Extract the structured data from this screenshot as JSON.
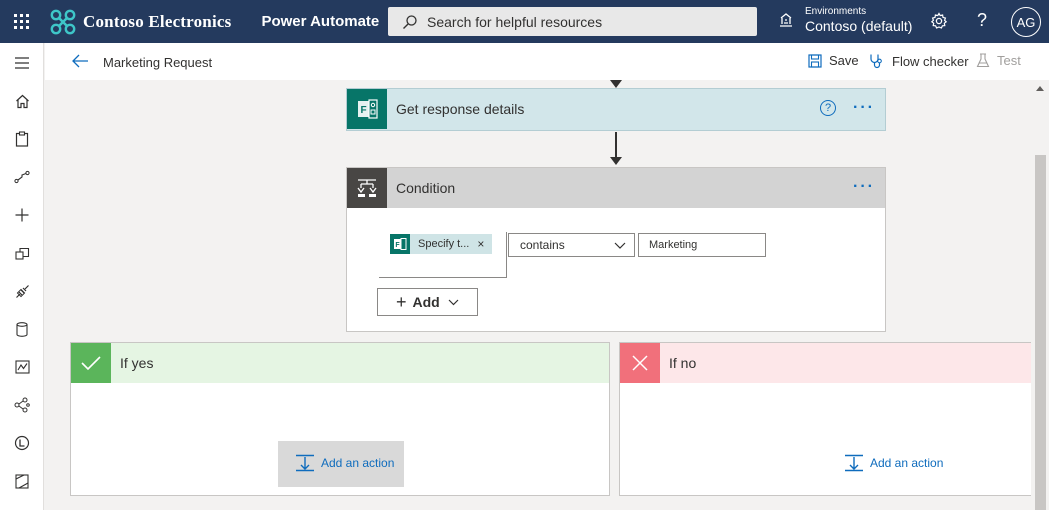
{
  "header": {
    "brand": "Contoso Electronics",
    "app": "Power Automate",
    "search_placeholder": "Search for helpful resources",
    "environment_label": "Environments",
    "environment_value": "Contoso (default)",
    "user_initials": "AG"
  },
  "rail": {
    "items": [
      "home-icon",
      "clipboard-icon",
      "flow-icon",
      "plus-icon",
      "templates-icon",
      "connector-icon",
      "data-icon",
      "monitor-icon",
      "ai-icon",
      "process-icon",
      "solutions-icon"
    ]
  },
  "command_bar": {
    "title": "Marketing Request",
    "save": "Save",
    "flow_checker": "Flow checker",
    "test": "Test"
  },
  "steps": {
    "get_response": {
      "title": "Get response details",
      "help": "?"
    },
    "condition": {
      "title": "Condition",
      "token_label": "Specify t...",
      "token_remove": "×",
      "operator": "contains",
      "value": "Marketing",
      "add_label": "Add"
    },
    "if_yes": {
      "title": "If yes",
      "add_action": "Add an action"
    },
    "if_no": {
      "title": "If no",
      "add_action": "Add an action"
    }
  },
  "colors": {
    "header_bg": "#243a5e",
    "forms_teal": "#077568",
    "get_response_bg": "#d2e6ea",
    "condition_head_bg": "#d3d3d3",
    "condition_icon_bg": "#484644",
    "yes_head_bg": "#e5f5e3",
    "yes_icon_bg": "#5bb55b",
    "no_head_bg": "#fde7e9",
    "no_icon_bg": "#f1707b",
    "link_blue": "#0f6cbd"
  }
}
